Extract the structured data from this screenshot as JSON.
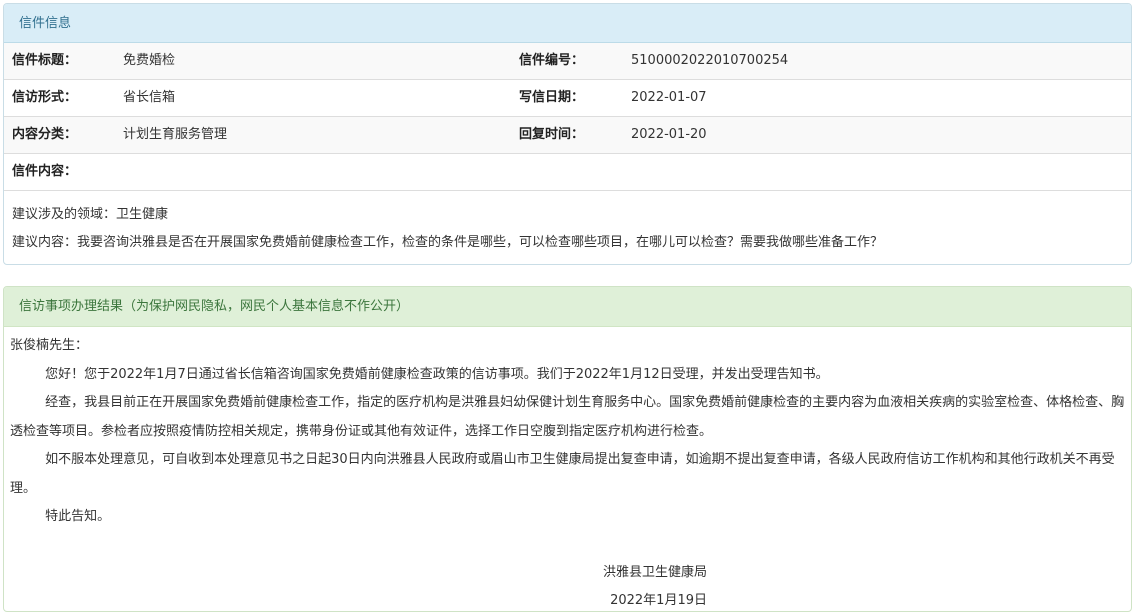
{
  "info_panel": {
    "header": "信件信息",
    "rows": [
      {
        "label1": "信件标题：",
        "value1": "免费婚检",
        "label2": "信件编号：",
        "value2": "5100002022010700254"
      },
      {
        "label1": "信访形式：",
        "value1": "省长信箱",
        "label2": "写信日期：",
        "value2": "2022-01-07"
      },
      {
        "label1": "内容分类：",
        "value1": "计划生育服务管理",
        "label2": "回复时间：",
        "value2": "2022-01-20"
      }
    ],
    "content_label": "信件内容：",
    "field_line": "建议涉及的领域：卫生健康",
    "content_line": "建议内容：我要咨询洪雅县是否在开展国家免费婚前健康检查工作，检查的条件是哪些，可以检查哪些项目，在哪儿可以检查？需要我做哪些准备工作？"
  },
  "result_panel": {
    "header": "信访事项办理结果（为保护网民隐私，网民个人基本信息不作公开）",
    "salutation": "张俊楠先生：",
    "paragraphs": [
      "您好！您于2022年1月7日通过省长信箱咨询国家免费婚前健康检查政策的信访事项。我们于2022年1月12日受理，并发出受理告知书。",
      "经查，我县目前正在开展国家免费婚前健康检查工作，指定的医疗机构是洪雅县妇幼保健计划生育服务中心。国家免费婚前健康检查的主要内容为血液相关疾病的实验室检查、体格检查、胸透检查等项目。参检者应按照疫情防控相关规定，携带身份证或其他有效证件，选择工作日空腹到指定医疗机构进行检查。",
      "如不服本处理意见，可自收到本处理意见书之日起30日内向洪雅县人民政府或眉山市卫生健康局提出复查申请，如逾期不提出复查申请，各级人民政府信访工作机构和其他行政机关不再受理。",
      "特此告知。"
    ],
    "signature_org": "洪雅县卫生健康局",
    "signature_date": "2022年1月19日"
  }
}
